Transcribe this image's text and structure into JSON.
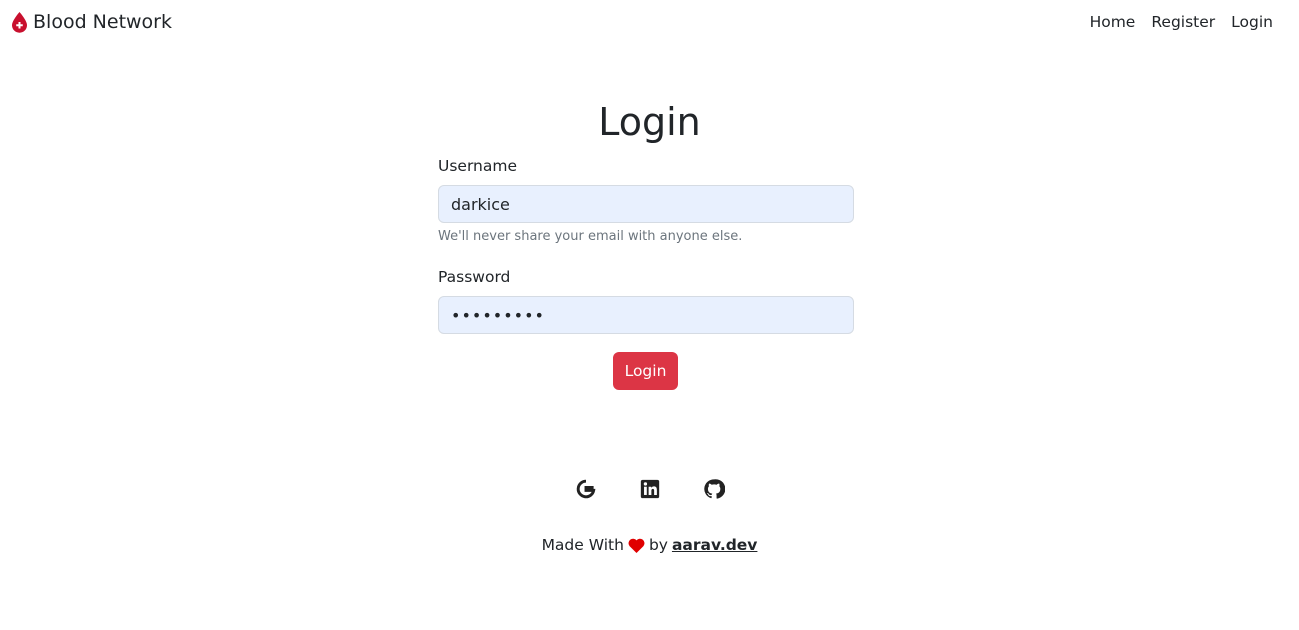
{
  "navbar": {
    "brand": "Blood Network",
    "brand_icon": "blood-drop-icon",
    "links": [
      "Home",
      "Register",
      "Login"
    ]
  },
  "page": {
    "title": "Login"
  },
  "form": {
    "username_label": "Username",
    "username_value": "darkice",
    "username_help": "We'll never share your email with anyone else.",
    "password_label": "Password",
    "password_value": "•••••••••",
    "submit_label": "Login"
  },
  "socials": [
    "google-icon",
    "linkedin-icon",
    "github-icon"
  ],
  "footer": {
    "made_with": "Made With",
    "by": "by",
    "author": "aarav.dev"
  },
  "colors": {
    "primary": "#dc3545",
    "heart": "#e00000",
    "input_bg": "#e8f0fe"
  }
}
